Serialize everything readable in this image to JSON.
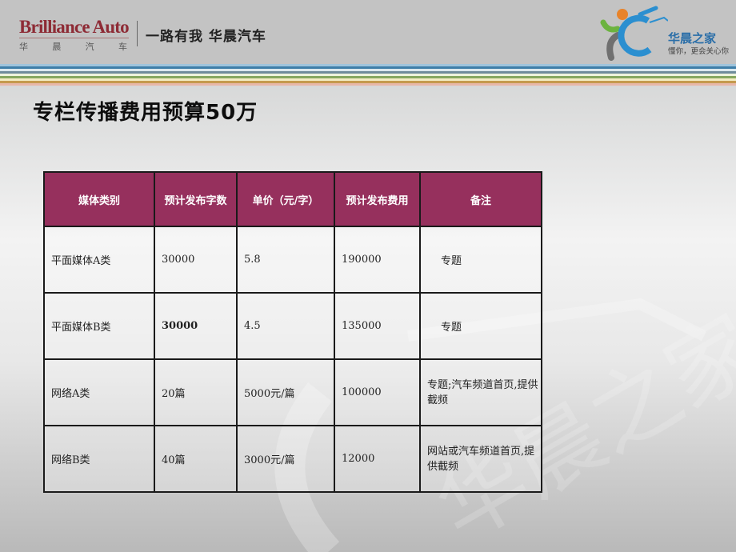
{
  "header": {
    "brand_name": "Brilliance Auto",
    "brand_sub_chars": [
      "华",
      "晨",
      "汽",
      "车"
    ],
    "slogan": "一路有我  华晨汽车",
    "partner_logo": {
      "title": "华晨之家",
      "tagline": "懂你，更会关心你"
    },
    "stripe_colors": [
      "#9fc4dc",
      "#3f7ea8",
      "#dbe8ee",
      "#6f8c9a",
      "#eef3dc",
      "#86a85e",
      "#f3edc4",
      "#c59a4e",
      "#e8b7a8"
    ]
  },
  "slide": {
    "title": "专栏传播费用预算50万"
  },
  "table": {
    "header_color": "#96305d",
    "columns": [
      "媒体类别",
      "预计发布字数",
      "单价（元/字）",
      "预计发布费用",
      "备注"
    ],
    "rows": [
      {
        "category": "平面媒体A类",
        "words": "30000",
        "unit_price": "5.8",
        "cost": "190000",
        "note": "专题"
      },
      {
        "category": "平面媒体B类",
        "words": "30000",
        "unit_price": "4.5",
        "cost": "135000",
        "note": "专题"
      },
      {
        "category": "网络A类",
        "words": "20篇",
        "unit_price": "5000元/篇",
        "cost": "100000",
        "note": "专题;汽车频道首页,提供截频"
      },
      {
        "category": "网络B类",
        "words": "40篇",
        "unit_price": "3000元/篇",
        "cost": "12000",
        "note": "网站或汽车频道首页,提供截频"
      }
    ]
  },
  "watermark": {
    "text": "华晨之家 懂你，更会关心你"
  }
}
